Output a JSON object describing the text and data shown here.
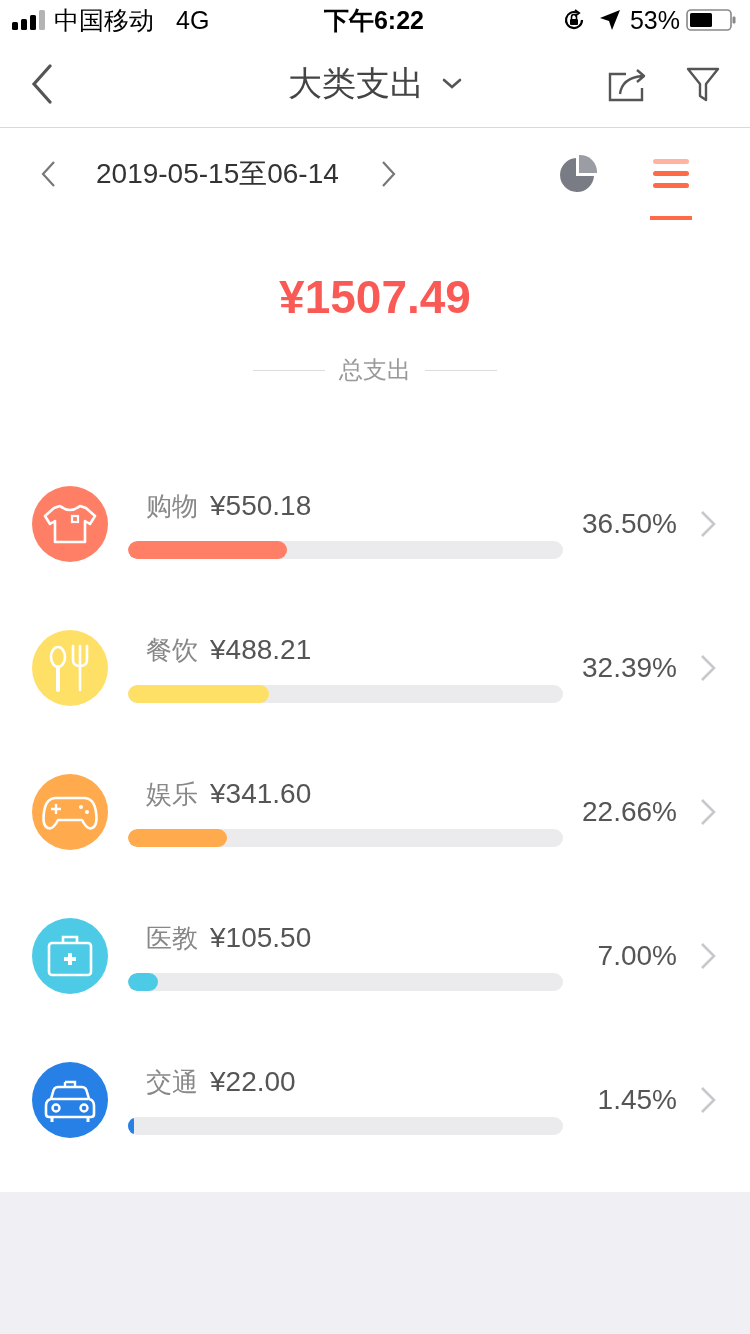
{
  "status_bar": {
    "carrier": "中国移动",
    "network": "4G",
    "time": "下午6:22",
    "battery": "53%"
  },
  "nav_bar": {
    "title": "大类支出"
  },
  "date_range": {
    "label": "2019-05-15至06-14"
  },
  "view_tabs": [
    {
      "kind": "pie",
      "selected": false
    },
    {
      "kind": "list",
      "selected": true
    }
  ],
  "summary": {
    "amount": "¥1507.49",
    "label": "总支出"
  },
  "categories": [
    {
      "kind": "shirt",
      "name": "购物",
      "amount": "¥550.18",
      "level": 0.365,
      "percent": "36.50%",
      "color": "#ff7f66"
    },
    {
      "kind": "utensils",
      "name": "餐饮",
      "amount": "¥488.21",
      "level": 0.3239,
      "percent": "32.39%",
      "color": "#ffe066"
    },
    {
      "kind": "gamepad",
      "name": "娱乐",
      "amount": "¥341.60",
      "level": 0.2266,
      "percent": "22.66%",
      "color": "#ffaa4d"
    },
    {
      "kind": "medkit",
      "name": "医教",
      "amount": "¥105.50",
      "level": 0.07,
      "percent": "7.00%",
      "color": "#4dcbe6"
    },
    {
      "kind": "taxi",
      "name": "交通",
      "amount": "¥22.00",
      "level": 0.0145,
      "percent": "1.45%",
      "color": "#2680e6"
    }
  ]
}
